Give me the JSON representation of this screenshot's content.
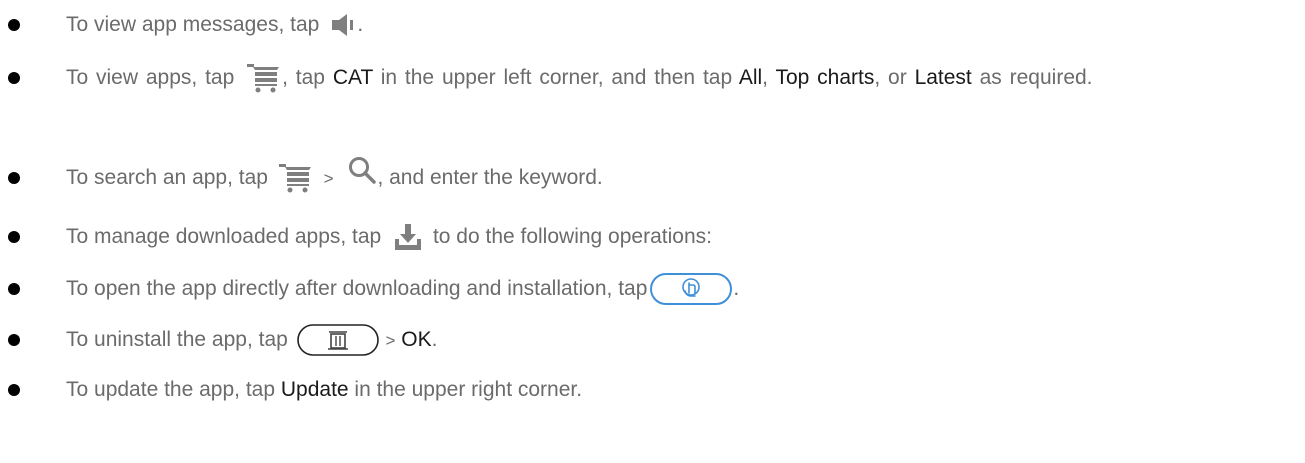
{
  "items": [
    {
      "t1": "To view app messages, tap",
      "icon": "speaker-icon",
      "t2": "."
    },
    {
      "t1": "To view apps, tap",
      "icon": "shopping-cart-icon",
      "t2": ", tap",
      "k1": "CAT",
      "t3": "in the upper left corner, and then tap",
      "k2": "All",
      "t4": ",",
      "k3": "Top charts",
      "t5": ", or",
      "k4": "Latest",
      "t6": "as required."
    },
    {
      "t1": "To search an app, tap",
      "icon1": "shopping-cart-icon",
      "sep": ">",
      "icon2": "search-icon",
      "t2": ", and enter the keyword."
    },
    {
      "t1": "To manage downloaded apps, tap",
      "icon": "download-icon",
      "t2": "to do the following operations:"
    },
    {
      "t1": "To open the app directly after downloading and installation, tap",
      "icon": "open-app-button-icon",
      "t2": "."
    },
    {
      "t1": "To uninstall the app, tap",
      "icon": "trash-button-icon",
      "sep": ">",
      "k1": "OK",
      "t2": "."
    },
    {
      "t1": "To update the app, tap",
      "k1": "Update",
      "t2": "in the upper right corner."
    }
  ],
  "colors": {
    "text": "#6b6b6b",
    "command": "#1a1a1a",
    "bullet": "#000000",
    "icon": "#7f7f7f",
    "button_outline": "#3f8fd9"
  }
}
